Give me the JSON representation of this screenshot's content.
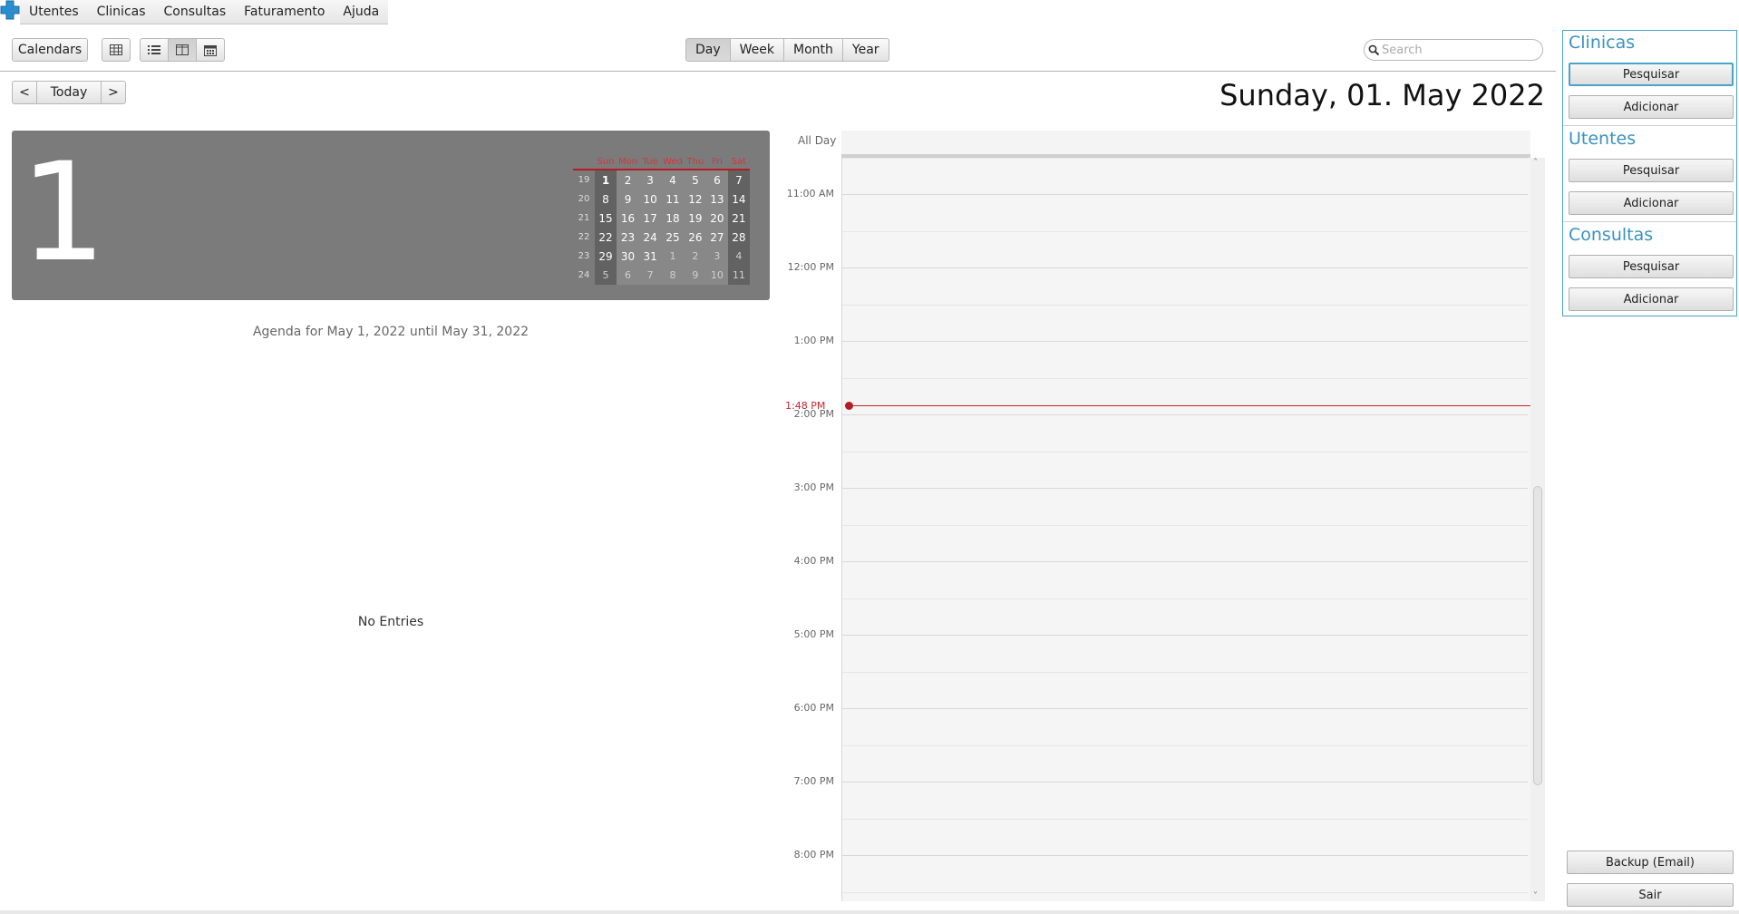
{
  "menu": [
    "Utentes",
    "Clinicas",
    "Consultas",
    "Faturamento",
    "Ajuda"
  ],
  "toolbar": {
    "calendars_label": "Calendars",
    "views": [
      "Day",
      "Week",
      "Month",
      "Year"
    ],
    "selected_view": "Day",
    "search_placeholder": "Search",
    "prev_label": "<",
    "today_label": "Today",
    "next_label": ">"
  },
  "header": {
    "date_title": "Sunday, 01. May 2022"
  },
  "day_panel": {
    "big_day": "1",
    "weekday_headers": [
      "Sun",
      "Mon",
      "Tue",
      "Wed",
      "Thu",
      "Fri",
      "Sat"
    ],
    "weeks": [
      {
        "wk": "19",
        "days": [
          "1",
          "2",
          "3",
          "4",
          "5",
          "6",
          "7"
        ]
      },
      {
        "wk": "20",
        "days": [
          "8",
          "9",
          "10",
          "11",
          "12",
          "13",
          "14"
        ]
      },
      {
        "wk": "21",
        "days": [
          "15",
          "16",
          "17",
          "18",
          "19",
          "20",
          "21"
        ]
      },
      {
        "wk": "22",
        "days": [
          "22",
          "23",
          "24",
          "25",
          "26",
          "27",
          "28"
        ]
      },
      {
        "wk": "23",
        "days": [
          "29",
          "30",
          "31",
          "1",
          "2",
          "3",
          "4"
        ]
      },
      {
        "wk": "24",
        "days": [
          "5",
          "6",
          "7",
          "8",
          "9",
          "10",
          "11"
        ]
      }
    ]
  },
  "agenda": {
    "title": "Agenda for May 1, 2022 until May 31, 2022",
    "empty_text": "No Entries"
  },
  "schedule": {
    "all_day_label": "All Day",
    "hours": [
      "11:00 AM",
      "12:00 PM",
      "1:00 PM",
      "2:00 PM",
      "3:00 PM",
      "4:00 PM",
      "5:00 PM",
      "6:00 PM",
      "7:00 PM",
      "8:00 PM"
    ],
    "current_time": "1:48 PM"
  },
  "sidebar": {
    "sections": [
      {
        "title": "Clinicas",
        "search": "Pesquisar",
        "add": "Adicionar"
      },
      {
        "title": "Utentes",
        "search": "Pesquisar",
        "add": "Adicionar"
      },
      {
        "title": "Consultas",
        "search": "Pesquisar",
        "add": "Adicionar"
      }
    ],
    "backup_label": "Backup (Email)",
    "exit_label": "Sair"
  },
  "colors": {
    "accent": "#3a92c0",
    "now_line": "#c4262e",
    "day_panel_bg": "#7b7b7b"
  }
}
